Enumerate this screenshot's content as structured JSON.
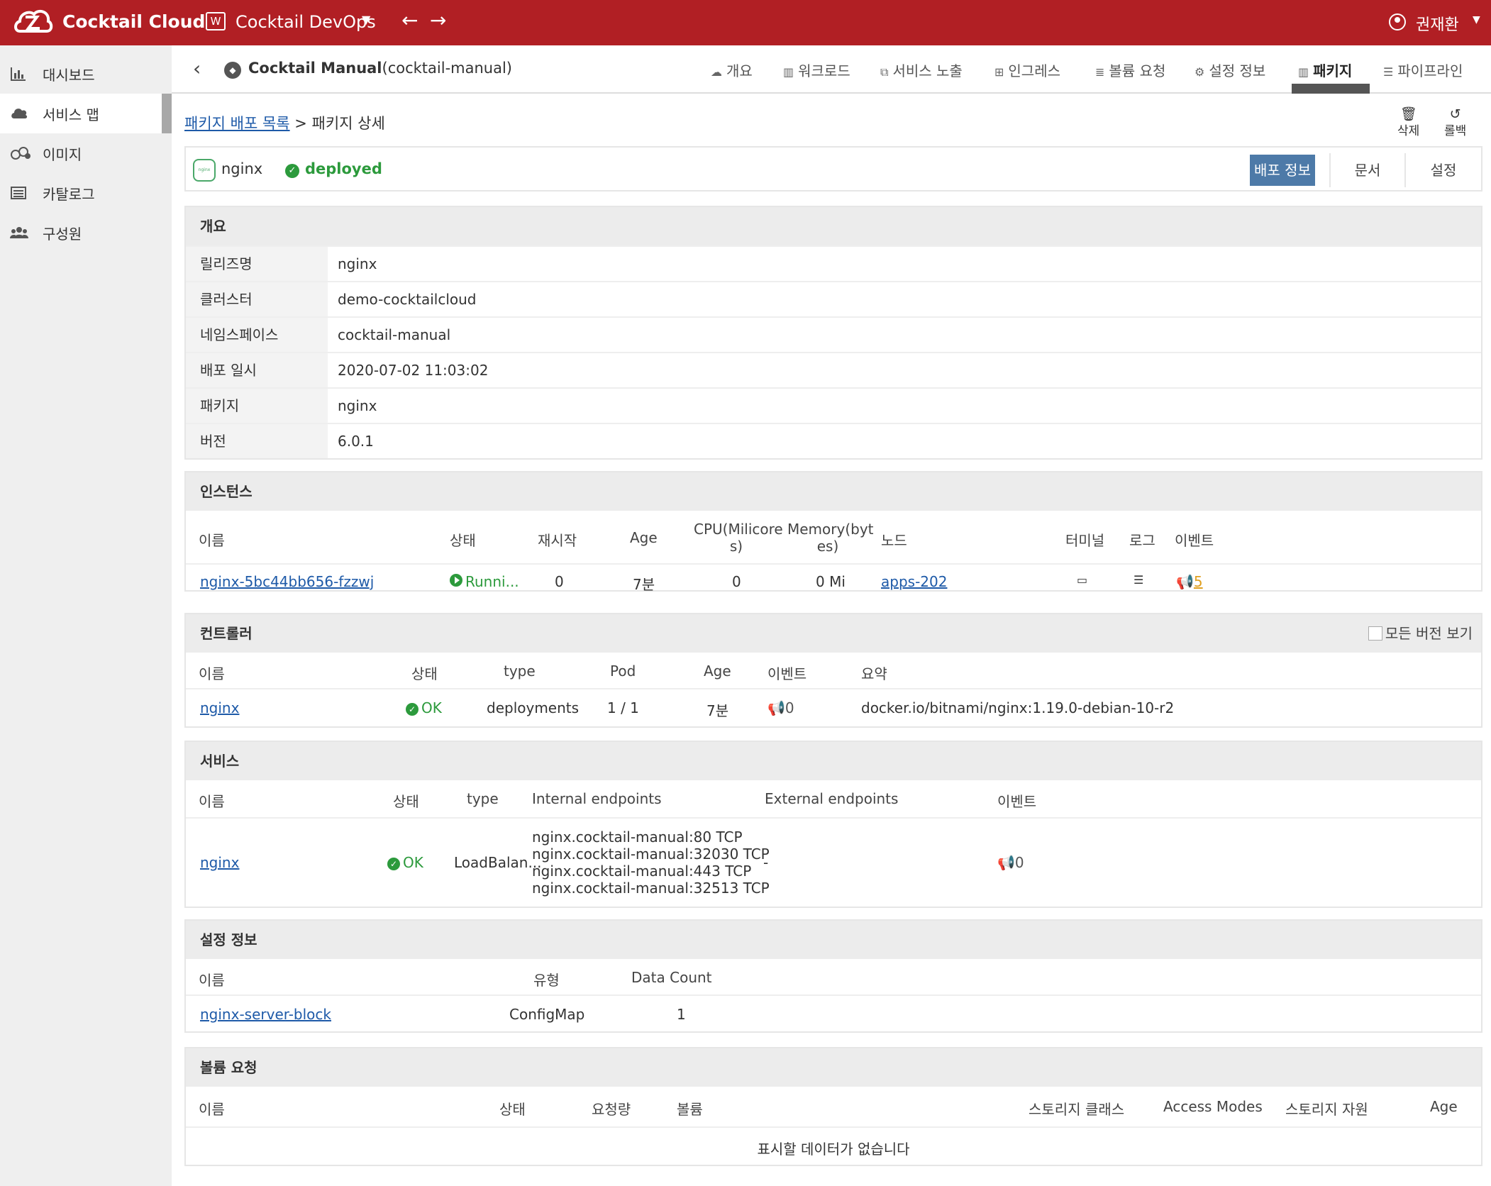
{
  "topbar": {
    "brand": "Cocktail Cloud",
    "workspace": "Cocktail DevOps",
    "workspace_icon_text": "W",
    "user": "권재환"
  },
  "sidebar": {
    "items": [
      {
        "label": "대시보드",
        "icon": "bar-chart-icon"
      },
      {
        "label": "서비스 맵",
        "icon": "cloud-icon",
        "active": true
      },
      {
        "label": "이미지",
        "icon": "images-icon"
      },
      {
        "label": "카탈로그",
        "icon": "catalog-icon"
      },
      {
        "label": "구성원",
        "icon": "users-icon"
      }
    ]
  },
  "subheader": {
    "app_name": "Cocktail Manual",
    "app_id": "(cocktail-manual)",
    "tabs": [
      {
        "label": "개요",
        "icon": "cloud-icon"
      },
      {
        "label": "워크로드",
        "icon": "map-icon"
      },
      {
        "label": "서비스 노출",
        "icon": "external-link-icon"
      },
      {
        "label": "인그레스",
        "icon": "sitemap-icon"
      },
      {
        "label": "볼륨 요청",
        "icon": "database-icon"
      },
      {
        "label": "설정 정보",
        "icon": "gear-icon"
      },
      {
        "label": "패키지",
        "icon": "map-icon",
        "active": true
      },
      {
        "label": "파이프라인",
        "icon": "list-icon"
      }
    ]
  },
  "breadcrumb": {
    "link": "패키지 배포 목록",
    "sep": " > ",
    "current": "패키지 상세"
  },
  "actions": {
    "delete": "삭제",
    "rollback": "롤백"
  },
  "package": {
    "logo_text": "nginx",
    "name": "nginx",
    "status": "deployed",
    "tabs": [
      "배포 정보",
      "문서",
      "설정"
    ]
  },
  "overview": {
    "title": "개요",
    "rows": [
      {
        "k": "릴리즈명",
        "v": "nginx"
      },
      {
        "k": "클러스터",
        "v": "demo-cocktailcloud"
      },
      {
        "k": "네임스페이스",
        "v": "cocktail-manual"
      },
      {
        "k": "배포 일시",
        "v": "2020-07-02 11:03:02"
      },
      {
        "k": "패키지",
        "v": "nginx"
      },
      {
        "k": "버전",
        "v": "6.0.1"
      }
    ]
  },
  "instances": {
    "title": "인스턴스",
    "headers": [
      "이름",
      "상태",
      "재시작",
      "Age",
      "CPU(Milicore",
      "s)",
      "Memory(byt",
      "es)",
      "노드",
      "터미널",
      "로그",
      "이벤트"
    ],
    "row": {
      "name": "nginx-5bc44bb656-fzzwj",
      "status": "Runni...",
      "restart": "0",
      "age": "7분",
      "cpu": "0",
      "memory": "0 Mi",
      "node": "apps-202",
      "events": "5"
    }
  },
  "controllers": {
    "title": "컨트롤러",
    "all_versions": "모든 버전 보기",
    "headers": [
      "이름",
      "상태",
      "type",
      "Pod",
      "Age",
      "이벤트",
      "요약"
    ],
    "row": {
      "name": "nginx",
      "status": "OK",
      "type": "deployments",
      "pod": "1 / 1",
      "age": "7분",
      "events": "0",
      "summary": "docker.io/bitnami/nginx:1.19.0-debian-10-r2"
    }
  },
  "services": {
    "title": "서비스",
    "headers": [
      "이름",
      "상태",
      "type",
      "Internal endpoints",
      "External endpoints",
      "이벤트"
    ],
    "row": {
      "name": "nginx",
      "status": "OK",
      "type": "LoadBalan...",
      "internal": [
        "nginx.cocktail-manual:80 TCP",
        "nginx.cocktail-manual:32030 TCP",
        "nginx.cocktail-manual:443 TCP",
        "nginx.cocktail-manual:32513 TCP"
      ],
      "external": "-",
      "events": "0"
    }
  },
  "configs": {
    "title": "설정 정보",
    "headers": [
      "이름",
      "유형",
      "Data Count"
    ],
    "row": {
      "name": "nginx-server-block",
      "type": "ConfigMap",
      "count": "1"
    }
  },
  "volumes": {
    "title": "볼륨 요청",
    "headers": [
      "이름",
      "상태",
      "요청량",
      "볼륨",
      "스토리지 클래스",
      "Access Modes",
      "스토리지 자원",
      "Age"
    ],
    "empty": "표시할 데이터가 없습니다"
  },
  "colors": {
    "topbar": "#b11f24",
    "accent": "#4d7aa8",
    "ok": "#2c9a3c",
    "event": "#e0a020",
    "link": "#1e5aa8"
  }
}
